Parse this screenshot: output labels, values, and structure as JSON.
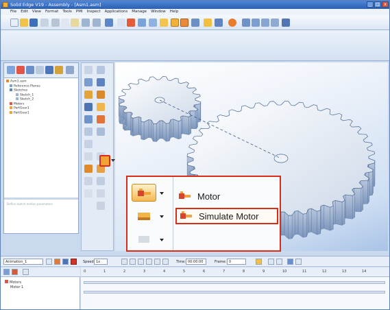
{
  "window": {
    "title": "Solid Edge V19 - Assembly - [Asm1.asm]",
    "controls": [
      "_",
      "□",
      "x"
    ]
  },
  "menu": {
    "items": [
      "File",
      "Edit",
      "View",
      "Format",
      "Tools",
      "PMI",
      "Inspect",
      "Applications",
      "Manage",
      "Window",
      "Help"
    ]
  },
  "pathfinder": {
    "tree": [
      "Asm1.asm",
      "Reference Planes",
      "Sketches",
      "Sketch_1",
      "Sketch_2",
      "Motors",
      "PartGear1",
      "PartGear1"
    ],
    "hint": "Define sketch motion parameters"
  },
  "popup": {
    "items": [
      {
        "label": "Motor",
        "icon": "motor-icon"
      },
      {
        "label": "Simulate Motor",
        "icon": "simulate-motor-icon"
      }
    ]
  },
  "animation_bar": {
    "animation_name": "Animation_1",
    "speed_label": "Speed:",
    "speed_value": "1x",
    "time_label": "Time:",
    "time_value": "00:00:00",
    "frame_label": "Frame:",
    "frame_value": "0"
  },
  "timeline": {
    "tree": [
      "Motors",
      "Motor 1"
    ],
    "ticks": [
      "0",
      "1",
      "2",
      "3",
      "4",
      "5",
      "6",
      "7",
      "8",
      "9",
      "10",
      "11",
      "12",
      "13",
      "14"
    ]
  },
  "colors": {
    "highlight": "#d92c18",
    "motor_orange": "#f3a335"
  }
}
